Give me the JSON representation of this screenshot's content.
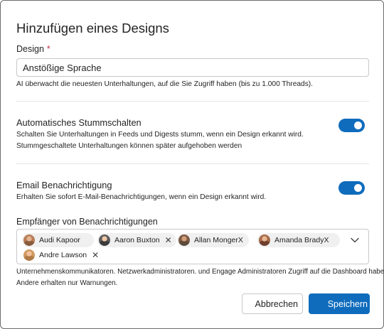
{
  "dialog": {
    "title": "Hinzufügen eines Designs"
  },
  "design": {
    "label": "Design",
    "required_mark": "*",
    "value": "Anstößige Sprache",
    "hint": "AI überwacht die neuesten Unterhaltungen, auf die Sie Zugriff haben (bis zu 1.000 Threads)."
  },
  "mute": {
    "heading": "Automatisches Stummschalten",
    "line1": "Schalten Sie Unterhaltungen in Feeds und Digests stumm, wenn ein Design erkannt wird.",
    "line2": "Stummgeschaltete Unterhaltungen können später aufgehoben werden",
    "enabled": true
  },
  "email": {
    "heading": "Email Benachrichtigung",
    "description": "Erhalten Sie sofort E-Mail-Benachrichtigungen, wenn ein Design erkannt wird.",
    "enabled": true
  },
  "recipients": {
    "label": "Empfänger von Benachrichtigungen",
    "people": [
      {
        "name": "Audi Kapoor",
        "remove": ""
      },
      {
        "name": "Aaron Buxton",
        "remove": "✕"
      },
      {
        "name": "Allan Monger",
        "remove": "X"
      },
      {
        "name": "Amanda Brady",
        "remove": "X"
      },
      {
        "name": "Andre Lawson",
        "remove": "✕"
      }
    ],
    "footer_line1": "Unternehmenskommunikatoren. Netzwerkadministratoren. und Engage Administratoren Zugriff auf die Dashboard haben.",
    "footer_line2": "Andere erhalten nur Warnungen."
  },
  "buttons": {
    "cancel": "Abbrechen",
    "save": "Speichern"
  },
  "colors": {
    "accent": "#0f6cbd",
    "required": "#c4314b"
  },
  "icons": {
    "dropdown": "chevron-down-icon",
    "remove": "close-icon"
  }
}
